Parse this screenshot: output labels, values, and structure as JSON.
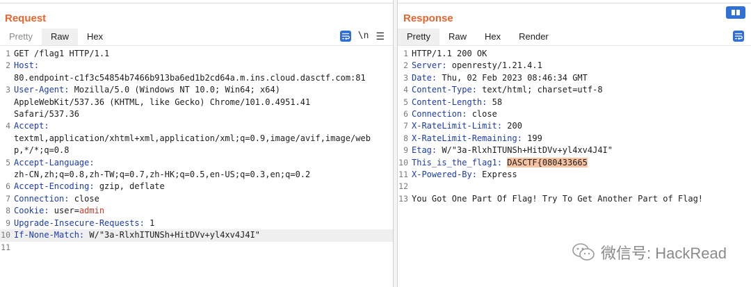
{
  "request": {
    "title": "Request",
    "tabs": [
      "Pretty",
      "Raw",
      "Hex"
    ],
    "active_tab": "Raw",
    "newline_toggle": "\\n",
    "lines": [
      {
        "n": "1",
        "parts": [
          {
            "t": "GET /flag1 HTTP/1.1",
            "c": "hval"
          }
        ]
      },
      {
        "n": "2",
        "parts": [
          {
            "t": "Host:",
            "c": "hname"
          }
        ]
      },
      {
        "n": "",
        "parts": [
          {
            "t": "80.endpoint-c1f3c54854b7466b913ba6ed1b2cd64a.m.ins.cloud.dasctf.com:81",
            "c": "hval"
          }
        ]
      },
      {
        "n": "3",
        "parts": [
          {
            "t": "User-Agent:",
            "c": "hname"
          },
          {
            "t": " Mozilla/5.0 (Windows NT 10.0; Win64; x64)",
            "c": "hval"
          }
        ]
      },
      {
        "n": "",
        "parts": [
          {
            "t": "AppleWebKit/537.36 (KHTML, like Gecko) Chrome/101.0.4951.41",
            "c": "hval"
          }
        ]
      },
      {
        "n": "",
        "parts": [
          {
            "t": "Safari/537.36",
            "c": "hval"
          }
        ]
      },
      {
        "n": "4",
        "parts": [
          {
            "t": "Accept:",
            "c": "hname"
          }
        ]
      },
      {
        "n": "",
        "parts": [
          {
            "t": "textml,application/xhtml+xml,application/xml;q=0.9,image/avif,image/web",
            "c": "hval"
          }
        ]
      },
      {
        "n": "",
        "parts": [
          {
            "t": "p,*/*;q=0.8",
            "c": "hval"
          }
        ]
      },
      {
        "n": "5",
        "parts": [
          {
            "t": "Accept-Language:",
            "c": "hname"
          }
        ]
      },
      {
        "n": "",
        "parts": [
          {
            "t": "zh-CN,zh;q=0.8,zh-TW;q=0.7,zh-HK;q=0.5,en-US;q=0.3,en;q=0.2",
            "c": "hval"
          }
        ]
      },
      {
        "n": "6",
        "parts": [
          {
            "t": "Accept-Encoding:",
            "c": "hname"
          },
          {
            "t": " gzip, deflate",
            "c": "hval"
          }
        ]
      },
      {
        "n": "7",
        "parts": [
          {
            "t": "Connection:",
            "c": "hname"
          },
          {
            "t": " close",
            "c": "hval"
          }
        ]
      },
      {
        "n": "8",
        "parts": [
          {
            "t": "Cookie:",
            "c": "hname"
          },
          {
            "t": " user",
            "c": "hval"
          },
          {
            "t": "=",
            "c": "hval"
          },
          {
            "t": "admin",
            "c": "cval"
          }
        ]
      },
      {
        "n": "9",
        "parts": [
          {
            "t": "Upgrade-Insecure-Requests:",
            "c": "hname"
          },
          {
            "t": " 1",
            "c": "hval"
          }
        ]
      },
      {
        "n": "10",
        "hl": true,
        "parts": [
          {
            "t": "If-None-Match:",
            "c": "hname"
          },
          {
            "t": " W/\"3a-RlxhITUNSh+HitDVv+yl4xv4J4I\"",
            "c": "hval"
          }
        ]
      },
      {
        "n": "11",
        "parts": []
      }
    ]
  },
  "response": {
    "title": "Response",
    "tabs": [
      "Pretty",
      "Raw",
      "Hex",
      "Render"
    ],
    "active_tab": "Pretty",
    "lines": [
      {
        "n": "1",
        "parts": [
          {
            "t": "HTTP/1.1 200 OK",
            "c": "hval"
          }
        ]
      },
      {
        "n": "2",
        "parts": [
          {
            "t": "Server:",
            "c": "hname"
          },
          {
            "t": " openresty/1.21.4.1",
            "c": "hval"
          }
        ]
      },
      {
        "n": "3",
        "parts": [
          {
            "t": "Date:",
            "c": "hname"
          },
          {
            "t": " Thu, 02 Feb 2023 08:46:34 GMT",
            "c": "hval"
          }
        ]
      },
      {
        "n": "4",
        "parts": [
          {
            "t": "Content-Type:",
            "c": "hname"
          },
          {
            "t": " text/html; charset=utf-8",
            "c": "hval"
          }
        ]
      },
      {
        "n": "5",
        "parts": [
          {
            "t": "Content-Length:",
            "c": "hname"
          },
          {
            "t": " 58",
            "c": "hval"
          }
        ]
      },
      {
        "n": "6",
        "parts": [
          {
            "t": "Connection:",
            "c": "hname"
          },
          {
            "t": " close",
            "c": "hval"
          }
        ]
      },
      {
        "n": "7",
        "parts": [
          {
            "t": "X-RateLimit-Limit:",
            "c": "hname"
          },
          {
            "t": " 200",
            "c": "hval"
          }
        ]
      },
      {
        "n": "8",
        "parts": [
          {
            "t": "X-RateLimit-Remaining:",
            "c": "hname"
          },
          {
            "t": " 199",
            "c": "hval"
          }
        ]
      },
      {
        "n": "9",
        "parts": [
          {
            "t": "Etag:",
            "c": "hname"
          },
          {
            "t": " W/\"3a-RlxhITUNSh+HitDVv+yl4xv4J4I\"",
            "c": "hval"
          }
        ]
      },
      {
        "n": "10",
        "parts": [
          {
            "t": "This_is_the_flag1:",
            "c": "hname"
          },
          {
            "t": " ",
            "c": "hval"
          },
          {
            "t": "DASCTF{080433665",
            "c": "flagbox"
          }
        ]
      },
      {
        "n": "11",
        "parts": [
          {
            "t": "X-Powered-By:",
            "c": "hname"
          },
          {
            "t": " Express",
            "c": "hval"
          }
        ]
      },
      {
        "n": "12",
        "parts": []
      },
      {
        "n": "13",
        "parts": [
          {
            "t": "You Got One Part Of Flag! Try To Get Another Part of Flag!",
            "c": "hval"
          }
        ]
      }
    ]
  },
  "watermark": "微信号: HackRead",
  "colors": {
    "accent": "#e8642c",
    "header_name": "#1c3bb0",
    "button": "#2f6fd6",
    "flag_highlight": "#f8c3a2",
    "cookie_value": "#d03a2a"
  }
}
